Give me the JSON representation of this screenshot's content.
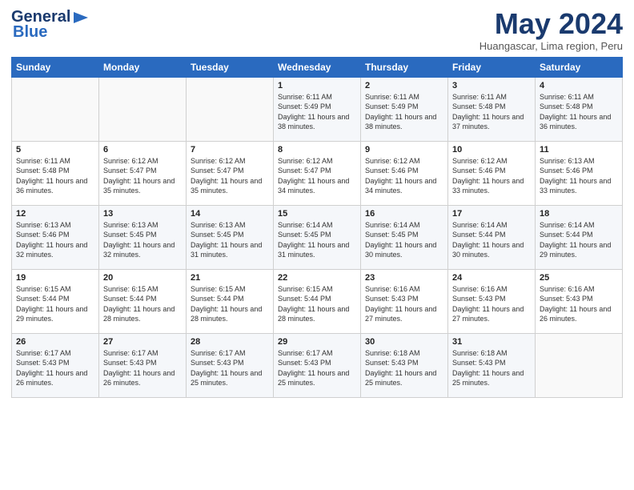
{
  "header": {
    "logo_line1": "General",
    "logo_line2": "Blue",
    "month_title": "May 2024",
    "subtitle": "Huangascar, Lima region, Peru"
  },
  "weekdays": [
    "Sunday",
    "Monday",
    "Tuesday",
    "Wednesday",
    "Thursday",
    "Friday",
    "Saturday"
  ],
  "weeks": [
    [
      {
        "day": "",
        "info": ""
      },
      {
        "day": "",
        "info": ""
      },
      {
        "day": "",
        "info": ""
      },
      {
        "day": "1",
        "info": "Sunrise: 6:11 AM\nSunset: 5:49 PM\nDaylight: 11 hours and 38 minutes."
      },
      {
        "day": "2",
        "info": "Sunrise: 6:11 AM\nSunset: 5:49 PM\nDaylight: 11 hours and 38 minutes."
      },
      {
        "day": "3",
        "info": "Sunrise: 6:11 AM\nSunset: 5:48 PM\nDaylight: 11 hours and 37 minutes."
      },
      {
        "day": "4",
        "info": "Sunrise: 6:11 AM\nSunset: 5:48 PM\nDaylight: 11 hours and 36 minutes."
      }
    ],
    [
      {
        "day": "5",
        "info": "Sunrise: 6:11 AM\nSunset: 5:48 PM\nDaylight: 11 hours and 36 minutes."
      },
      {
        "day": "6",
        "info": "Sunrise: 6:12 AM\nSunset: 5:47 PM\nDaylight: 11 hours and 35 minutes."
      },
      {
        "day": "7",
        "info": "Sunrise: 6:12 AM\nSunset: 5:47 PM\nDaylight: 11 hours and 35 minutes."
      },
      {
        "day": "8",
        "info": "Sunrise: 6:12 AM\nSunset: 5:47 PM\nDaylight: 11 hours and 34 minutes."
      },
      {
        "day": "9",
        "info": "Sunrise: 6:12 AM\nSunset: 5:46 PM\nDaylight: 11 hours and 34 minutes."
      },
      {
        "day": "10",
        "info": "Sunrise: 6:12 AM\nSunset: 5:46 PM\nDaylight: 11 hours and 33 minutes."
      },
      {
        "day": "11",
        "info": "Sunrise: 6:13 AM\nSunset: 5:46 PM\nDaylight: 11 hours and 33 minutes."
      }
    ],
    [
      {
        "day": "12",
        "info": "Sunrise: 6:13 AM\nSunset: 5:46 PM\nDaylight: 11 hours and 32 minutes."
      },
      {
        "day": "13",
        "info": "Sunrise: 6:13 AM\nSunset: 5:45 PM\nDaylight: 11 hours and 32 minutes."
      },
      {
        "day": "14",
        "info": "Sunrise: 6:13 AM\nSunset: 5:45 PM\nDaylight: 11 hours and 31 minutes."
      },
      {
        "day": "15",
        "info": "Sunrise: 6:14 AM\nSunset: 5:45 PM\nDaylight: 11 hours and 31 minutes."
      },
      {
        "day": "16",
        "info": "Sunrise: 6:14 AM\nSunset: 5:45 PM\nDaylight: 11 hours and 30 minutes."
      },
      {
        "day": "17",
        "info": "Sunrise: 6:14 AM\nSunset: 5:44 PM\nDaylight: 11 hours and 30 minutes."
      },
      {
        "day": "18",
        "info": "Sunrise: 6:14 AM\nSunset: 5:44 PM\nDaylight: 11 hours and 29 minutes."
      }
    ],
    [
      {
        "day": "19",
        "info": "Sunrise: 6:15 AM\nSunset: 5:44 PM\nDaylight: 11 hours and 29 minutes."
      },
      {
        "day": "20",
        "info": "Sunrise: 6:15 AM\nSunset: 5:44 PM\nDaylight: 11 hours and 28 minutes."
      },
      {
        "day": "21",
        "info": "Sunrise: 6:15 AM\nSunset: 5:44 PM\nDaylight: 11 hours and 28 minutes."
      },
      {
        "day": "22",
        "info": "Sunrise: 6:15 AM\nSunset: 5:44 PM\nDaylight: 11 hours and 28 minutes."
      },
      {
        "day": "23",
        "info": "Sunrise: 6:16 AM\nSunset: 5:43 PM\nDaylight: 11 hours and 27 minutes."
      },
      {
        "day": "24",
        "info": "Sunrise: 6:16 AM\nSunset: 5:43 PM\nDaylight: 11 hours and 27 minutes."
      },
      {
        "day": "25",
        "info": "Sunrise: 6:16 AM\nSunset: 5:43 PM\nDaylight: 11 hours and 26 minutes."
      }
    ],
    [
      {
        "day": "26",
        "info": "Sunrise: 6:17 AM\nSunset: 5:43 PM\nDaylight: 11 hours and 26 minutes."
      },
      {
        "day": "27",
        "info": "Sunrise: 6:17 AM\nSunset: 5:43 PM\nDaylight: 11 hours and 26 minutes."
      },
      {
        "day": "28",
        "info": "Sunrise: 6:17 AM\nSunset: 5:43 PM\nDaylight: 11 hours and 25 minutes."
      },
      {
        "day": "29",
        "info": "Sunrise: 6:17 AM\nSunset: 5:43 PM\nDaylight: 11 hours and 25 minutes."
      },
      {
        "day": "30",
        "info": "Sunrise: 6:18 AM\nSunset: 5:43 PM\nDaylight: 11 hours and 25 minutes."
      },
      {
        "day": "31",
        "info": "Sunrise: 6:18 AM\nSunset: 5:43 PM\nDaylight: 11 hours and 25 minutes."
      },
      {
        "day": "",
        "info": ""
      }
    ]
  ]
}
